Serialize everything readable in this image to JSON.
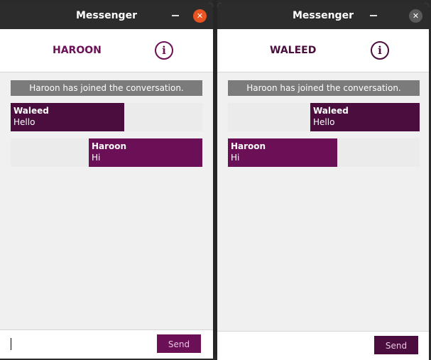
{
  "windows": [
    {
      "title": "Messenger",
      "contact": "HAROON",
      "system_message": "Haroon has joined the conversation.",
      "messages": [
        {
          "sender": "Waleed",
          "text": "Hello"
        },
        {
          "sender": "Haroon",
          "text": "Hi"
        }
      ],
      "input_value": "",
      "send_label": "Send"
    },
    {
      "title": "Messenger",
      "contact": "WALEED",
      "system_message": "Haroon has joined the conversation.",
      "messages": [
        {
          "sender": "Waleed",
          "text": "Hello"
        },
        {
          "sender": "Haroon",
          "text": "Hi"
        }
      ],
      "input_value": "",
      "send_label": "Send"
    }
  ],
  "icons": {
    "info": "i",
    "close": "✕"
  },
  "colors": {
    "accent": "#6b0f56",
    "accent_dark": "#4a0d3e",
    "close_active": "#e95420",
    "close_inactive": "#5a5a5a",
    "system_bg": "#7b7b7b"
  }
}
